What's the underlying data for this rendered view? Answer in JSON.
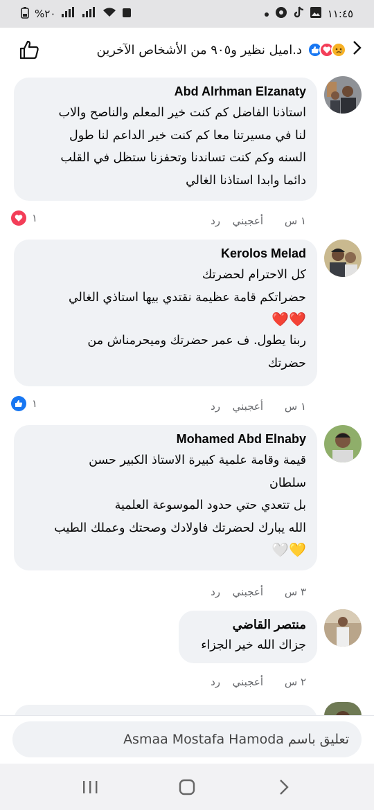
{
  "status": {
    "time": "١١:٤٥",
    "battery": "%٢٠"
  },
  "header": {
    "reactors": "د.اميل نظير و٩٠٥ من الأشخاص الآخرين"
  },
  "comments": [
    {
      "author": "Abd Alrhman Elzanaty",
      "text": "استاذنا الفاضل كم كنت خير المعلم والناصح والاب\nلنا في مسيرتنا معا كم كنت خير الداعم لنا طول\nالسنه وكم كنت تساندنا وتحفزنا ستظل في القلب\nدائما وابدا استاذنا الغالي",
      "time": "١ س",
      "like": "أعجبني",
      "reply": "رد",
      "react_count": "١",
      "react_type": "love"
    },
    {
      "author": "Kerolos Melad",
      "text": "كل الاحترام لحضرتك\nحضراتكم قامة عظيمة نقتدي بيها استاذي الغالي",
      "emoji": "❤️❤️",
      "text2": "ربنا يطول. ف عمر حضرتك وميحرمناش من\nحضرتك",
      "time": "١ س",
      "like": "أعجبني",
      "reply": "رد",
      "react_count": "١",
      "react_type": "like"
    },
    {
      "author": "Mohamed Abd Elnaby",
      "text": "قيمة وقامة علمية كبيرة  الاستاذ الكبير حسن\nسلطان\nبل تتعدي حتي حدود الموسوعة العلمية\nالله يبارك لحضرتك فاولادك وصحتك وعملك الطيب",
      "emoji": "💛🤍",
      "time": "٣ س",
      "like": "أعجبني",
      "reply": "رد"
    },
    {
      "author": "منتصر القاضي",
      "text": "جزاك الله خير الجزاء",
      "time": "٢ س",
      "like": "أعجبني",
      "reply": "رد"
    }
  ],
  "composer": {
    "placeholder": "تعليق باسم Asmaa Mostafa Hamoda"
  },
  "colors": {
    "bubble": "#f0f2f5",
    "like_blue": "#1877f2",
    "love_red": "#f33e58",
    "meta_gray": "#65676b"
  }
}
